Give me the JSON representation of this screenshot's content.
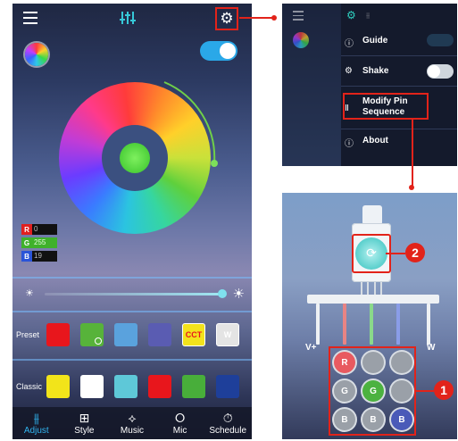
{
  "main": {
    "rgb": [
      {
        "tag": "R",
        "value": "0",
        "color": "#e02020"
      },
      {
        "tag": "G",
        "value": "255",
        "color": "#3fb12a"
      },
      {
        "tag": "B",
        "value": "19",
        "color": "#2a54d8"
      }
    ],
    "preset_label": "Preset",
    "preset_swatches": [
      {
        "color": "#e8161c",
        "label": ""
      },
      {
        "color": "#57b33a",
        "label": ""
      },
      {
        "color": "#5aa2dd",
        "label": ""
      },
      {
        "color": "#5a5cb2",
        "label": ""
      },
      {
        "color": "#f3e21c",
        "label": "CCT"
      },
      {
        "color": "#e4e4e4",
        "label": "W"
      }
    ],
    "classic_label": "Classic",
    "classic_swatches": [
      "#f2e41a",
      "#ffffff",
      "#5ec8d8",
      "#e8161c",
      "#48ae3a",
      "#1e3f9a"
    ],
    "tabs": [
      {
        "label": "Adjust",
        "icon": "equalizer-icon",
        "glyph": "⫵"
      },
      {
        "label": "Style",
        "icon": "grid-icon",
        "glyph": "⊞"
      },
      {
        "label": "Music",
        "icon": "music-icon",
        "glyph": "⟡"
      },
      {
        "label": "Mic",
        "icon": "microphone-icon",
        "glyph": "⭘"
      },
      {
        "label": "Schedule",
        "icon": "timer-icon",
        "glyph": "⏱"
      }
    ]
  },
  "settings_menu": {
    "items": [
      {
        "label": "Guide",
        "icon": "help-icon",
        "glyph": "ⓘ"
      },
      {
        "label": "Shake",
        "icon": "shake-icon",
        "glyph": "⚙"
      },
      {
        "label": "Modify Pin\nSequence",
        "icon": "pin-icon",
        "glyph": "Ⅱ"
      },
      {
        "label": "About",
        "icon": "info-icon",
        "glyph": "ⓘ"
      }
    ]
  },
  "hardware": {
    "wire_labels": [
      "V+",
      "W"
    ],
    "pin_grid": [
      [
        {
          "label": "R",
          "color": "#e85a60"
        },
        {
          "label": "",
          "color": "#9aa0a8"
        },
        {
          "label": "",
          "color": "#9aa0a8"
        }
      ],
      [
        {
          "label": "G",
          "color": "#9aa0a8"
        },
        {
          "label": "G",
          "color": "#4cb240"
        },
        {
          "label": "",
          "color": "#9aa0a8"
        }
      ],
      [
        {
          "label": "B",
          "color": "#9aa0a8"
        },
        {
          "label": "B",
          "color": "#9aa0a8"
        },
        {
          "label": "B",
          "color": "#4a5ab8"
        }
      ]
    ]
  },
  "callouts": [
    "1",
    "2"
  ],
  "colors": {
    "accent": "#31b4ef",
    "highlight": "#e2231a"
  }
}
